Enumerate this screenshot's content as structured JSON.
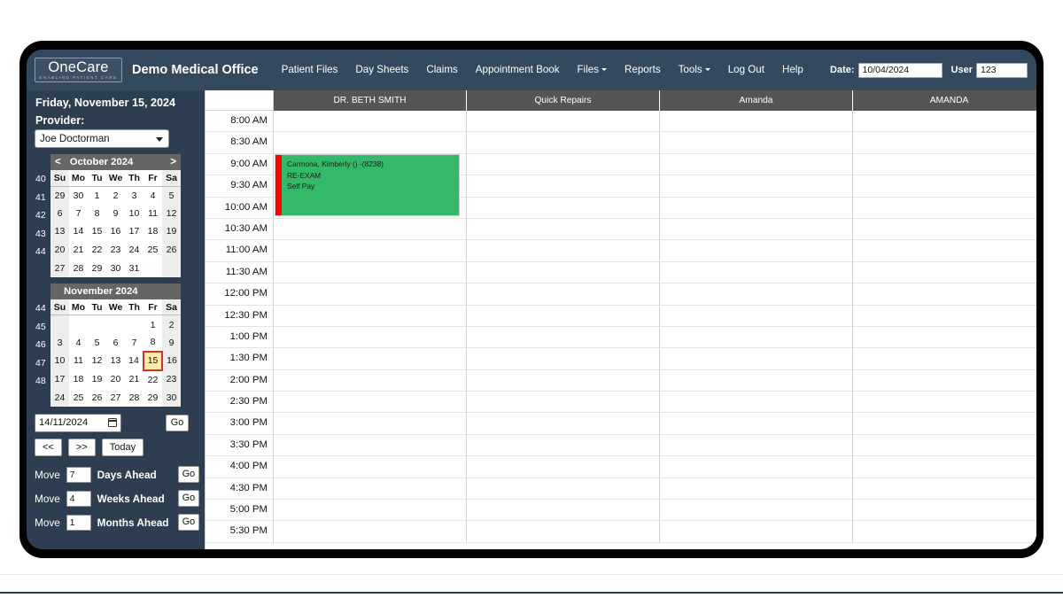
{
  "app": {
    "logo_word": "OneCare",
    "logo_tagline": "ENABLING PATIENT CARE",
    "office_title": "Demo Medical Office"
  },
  "nav": {
    "items": [
      {
        "label": "Patient Files",
        "caret": false
      },
      {
        "label": "Day Sheets",
        "caret": false
      },
      {
        "label": "Claims",
        "caret": false
      },
      {
        "label": "Appointment Book",
        "caret": false
      },
      {
        "label": "Files",
        "caret": true
      },
      {
        "label": "Reports",
        "caret": false
      },
      {
        "label": "Tools",
        "caret": true
      },
      {
        "label": "Log Out",
        "caret": false
      },
      {
        "label": "Help",
        "caret": false
      }
    ]
  },
  "topright": {
    "date_label": "Date:",
    "date_value": "10/04/2024",
    "user_label": "User",
    "user_value": "123"
  },
  "sidebar": {
    "current_date": "Friday, November 15, 2024",
    "provider_label": "Provider:",
    "provider_selected": "Joe Doctorman",
    "date_field_value": "14/11/2024",
    "go_label": "Go",
    "prev_label": "<<",
    "next_label": ">>",
    "today_label": "Today",
    "moves": [
      {
        "prefix": "Move",
        "value": "7",
        "unit": "Days Ahead",
        "go": "Go"
      },
      {
        "prefix": "Move",
        "value": "4",
        "unit": "Weeks Ahead",
        "go": "Go"
      },
      {
        "prefix": "Move",
        "value": "1",
        "unit": "Months Ahead",
        "go": "Go"
      }
    ],
    "calendars": [
      {
        "title": "October 2024",
        "prev": "<",
        "next": ">",
        "dow": [
          "Su",
          "Mo",
          "Tu",
          "We",
          "Th",
          "Fr",
          "Sa"
        ],
        "weeks": [
          "40",
          "41",
          "42",
          "43",
          "44"
        ],
        "rows": [
          [
            {
              "d": "29",
              "dim": true
            },
            {
              "d": "30",
              "dim": true
            },
            {
              "d": "1"
            },
            {
              "d": "2"
            },
            {
              "d": "3"
            },
            {
              "d": "4"
            },
            {
              "d": "5"
            }
          ],
          [
            {
              "d": "6"
            },
            {
              "d": "7"
            },
            {
              "d": "8"
            },
            {
              "d": "9"
            },
            {
              "d": "10"
            },
            {
              "d": "11"
            },
            {
              "d": "12"
            }
          ],
          [
            {
              "d": "13"
            },
            {
              "d": "14"
            },
            {
              "d": "15"
            },
            {
              "d": "16"
            },
            {
              "d": "17"
            },
            {
              "d": "18"
            },
            {
              "d": "19"
            }
          ],
          [
            {
              "d": "20"
            },
            {
              "d": "21"
            },
            {
              "d": "22"
            },
            {
              "d": "23"
            },
            {
              "d": "24"
            },
            {
              "d": "25"
            },
            {
              "d": "26"
            }
          ],
          [
            {
              "d": "27"
            },
            {
              "d": "28"
            },
            {
              "d": "29"
            },
            {
              "d": "30"
            },
            {
              "d": "31"
            },
            {
              "d": ""
            },
            {
              "d": ""
            }
          ]
        ]
      },
      {
        "title": "November 2024",
        "prev": "",
        "next": "",
        "dow": [
          "Su",
          "Mo",
          "Tu",
          "We",
          "Th",
          "Fr",
          "Sa"
        ],
        "weeks": [
          "44",
          "45",
          "46",
          "47",
          "48"
        ],
        "rows": [
          [
            {
              "d": ""
            },
            {
              "d": ""
            },
            {
              "d": ""
            },
            {
              "d": ""
            },
            {
              "d": ""
            },
            {
              "d": "1"
            },
            {
              "d": "2"
            }
          ],
          [
            {
              "d": "3"
            },
            {
              "d": "4"
            },
            {
              "d": "5"
            },
            {
              "d": "6"
            },
            {
              "d": "7"
            },
            {
              "d": "8"
            },
            {
              "d": "9"
            }
          ],
          [
            {
              "d": "10"
            },
            {
              "d": "11"
            },
            {
              "d": "12"
            },
            {
              "d": "13"
            },
            {
              "d": "14"
            },
            {
              "d": "15",
              "today": true
            },
            {
              "d": "16"
            }
          ],
          [
            {
              "d": "17"
            },
            {
              "d": "18"
            },
            {
              "d": "19"
            },
            {
              "d": "20"
            },
            {
              "d": "21"
            },
            {
              "d": "22"
            },
            {
              "d": "23"
            }
          ],
          [
            {
              "d": "24"
            },
            {
              "d": "25"
            },
            {
              "d": "26"
            },
            {
              "d": "27"
            },
            {
              "d": "28"
            },
            {
              "d": "29"
            },
            {
              "d": "30"
            }
          ]
        ]
      }
    ]
  },
  "schedule": {
    "columns": [
      "DR. BETH SMITH",
      "Quick Repairs",
      "Amanda",
      "AMANDA"
    ],
    "times": [
      "8:00 AM",
      "8:30 AM",
      "9:00 AM",
      "9:30 AM",
      "10:00 AM",
      "10:30 AM",
      "11:00 AM",
      "11:30 AM",
      "12:00 PM",
      "12:30 PM",
      "1:00 PM",
      "1:30 PM",
      "2:00 PM",
      "2:30 PM",
      "3:00 PM",
      "3:30 PM",
      "4:00 PM",
      "4:30 PM",
      "5:00 PM",
      "5:30 PM"
    ],
    "appointments": [
      {
        "column": 0,
        "start_index": 2,
        "span": 2.85,
        "patient": "Carmona, Kimberly () -(8238)",
        "type": "RE-EXAM",
        "payer": "Self Pay",
        "fill_color": "#34b86a",
        "accent_color": "#ff0000"
      }
    ]
  }
}
